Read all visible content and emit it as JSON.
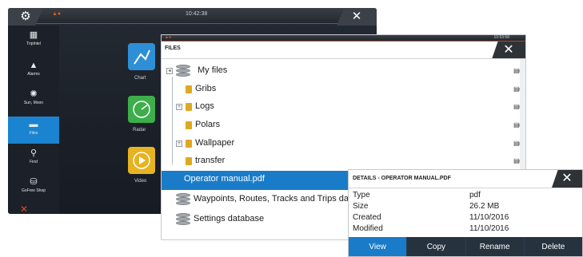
{
  "device": {
    "clock": "10:42:38",
    "sidebar": [
      {
        "label": "TripIntel",
        "icon": "tripintel-icon",
        "glyph": "▦"
      },
      {
        "label": "Alarms",
        "icon": "bell-icon",
        "glyph": "▲"
      },
      {
        "label": "Sun, Moon",
        "icon": "sun-icon",
        "glyph": "✺"
      },
      {
        "label": "Files",
        "icon": "folder-icon",
        "glyph": "▬",
        "active": true
      },
      {
        "label": "Find",
        "icon": "magnifier-icon",
        "glyph": "⚲"
      },
      {
        "label": "GoFree Shop",
        "icon": "shop-icon",
        "glyph": "⛁"
      }
    ],
    "apps": [
      {
        "label": "Chart",
        "color": "#2d8fd5"
      },
      {
        "label": "Radar",
        "color": "#3cae4b"
      },
      {
        "label": "Video",
        "color": "#e7b321"
      }
    ]
  },
  "files": {
    "clock": "10:53:58",
    "title": "FILES",
    "items": [
      {
        "label": "My files",
        "kind": "database",
        "level": 0,
        "expander": "◂"
      },
      {
        "label": "Gribs",
        "kind": "folder",
        "level": 1
      },
      {
        "label": "Logs",
        "kind": "folder",
        "level": 1,
        "expander": "+"
      },
      {
        "label": "Polars",
        "kind": "folder",
        "level": 1
      },
      {
        "label": "Wallpaper",
        "kind": "folder",
        "level": 1,
        "expander": "+"
      },
      {
        "label": "transfer",
        "kind": "folder",
        "level": 1
      },
      {
        "label": "Operator manual.pdf",
        "kind": "file",
        "level": 1,
        "selected": true
      },
      {
        "label": "Waypoints, Routes, Tracks and Trips database",
        "kind": "database",
        "level": 0
      },
      {
        "label": "Settings database",
        "kind": "database",
        "level": 0
      }
    ]
  },
  "details": {
    "title": "DETAILS - OPERATOR MANUAL.PDF",
    "properties": [
      {
        "name": "Type",
        "value": "pdf"
      },
      {
        "name": "Size",
        "value": "26.2 MB"
      },
      {
        "name": "Created",
        "value": "11/10/2016"
      },
      {
        "name": "Modified",
        "value": "11/10/2016"
      }
    ],
    "actions": [
      "View",
      "Copy",
      "Rename",
      "Delete"
    ]
  },
  "colors": {
    "accent": "#1a7cc8",
    "folder": "#e0a820",
    "delete_underline": "#d62e2e"
  }
}
